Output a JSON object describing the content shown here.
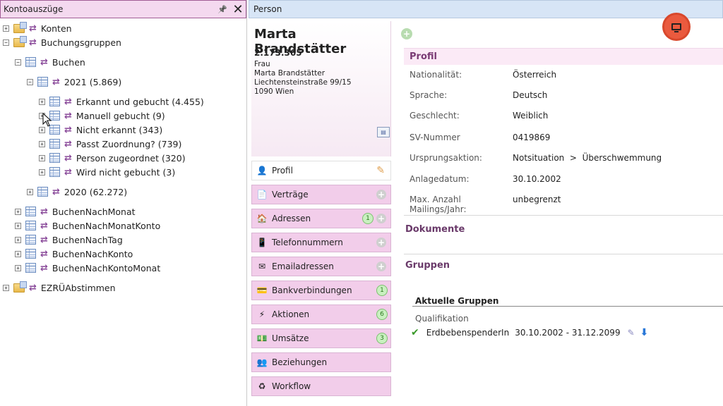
{
  "left_panel": {
    "title": "Kontoauszüge",
    "pin_icon": "pin-icon",
    "close_icon": "close-icon",
    "pin_glyph": "📌",
    "close_glyph": "✕",
    "tree": [
      {
        "label": "Konten",
        "icon": "folder",
        "expander": "+"
      },
      {
        "label": "Buchungsgruppen",
        "icon": "folder",
        "expander": "−"
      },
      {
        "label": "Buchen",
        "icon": "table",
        "expander": "−"
      },
      {
        "label": "2021 (5.869)",
        "icon": "table",
        "expander": "−"
      },
      {
        "label": "Erkannt und gebucht (4.455)",
        "icon": "table",
        "expander": "+"
      },
      {
        "label": "Manuell gebucht (9)",
        "icon": "table",
        "expander": "+"
      },
      {
        "label": "Nicht erkannt (343)",
        "icon": "table",
        "expander": "+"
      },
      {
        "label": "Passt Zuordnung? (739)",
        "icon": "table",
        "expander": "+"
      },
      {
        "label": "Person zugeordnet (320)",
        "icon": "table",
        "expander": "+"
      },
      {
        "label": "Wird nicht gebucht (3)",
        "icon": "table",
        "expander": "+"
      },
      {
        "label": "2020 (62.272)",
        "icon": "table",
        "expander": "+"
      },
      {
        "label": "BuchenNachMonat",
        "icon": "table",
        "expander": "+"
      },
      {
        "label": "BuchenNachMonatKonto",
        "icon": "table",
        "expander": "+"
      },
      {
        "label": "BuchenNachTag",
        "icon": "table",
        "expander": "+"
      },
      {
        "label": "BuchenNachKonto",
        "icon": "table",
        "expander": "+"
      },
      {
        "label": "BuchenNachKontoMonat",
        "icon": "table",
        "expander": "+"
      },
      {
        "label": "EZRÜAbstimmen",
        "icon": "folder",
        "expander": "+"
      }
    ]
  },
  "person": {
    "header": "Person",
    "name": "Marta Brandstätter",
    "number": "2.173.365",
    "address": [
      "Frau",
      "Marta Brandstätter",
      "Liechtensteinstraße 99/15",
      "1090 Wien"
    ]
  },
  "nav": [
    {
      "label": "Profil",
      "icon": "person-icon",
      "glyph": "👤",
      "badge": "",
      "plus": false,
      "active": true
    },
    {
      "label": "Verträge",
      "icon": "contract-icon",
      "glyph": "📄",
      "badge": "",
      "plus": true,
      "active": false
    },
    {
      "label": "Adressen",
      "icon": "house-icon",
      "glyph": "🏠",
      "badge": "1",
      "plus": true,
      "active": false
    },
    {
      "label": "Telefonnummern",
      "icon": "phone-icon",
      "glyph": "📱",
      "badge": "",
      "plus": true,
      "active": false
    },
    {
      "label": "Emailadressen",
      "icon": "envelope-icon",
      "glyph": "✉",
      "badge": "",
      "plus": true,
      "active": false
    },
    {
      "label": "Bankverbindungen",
      "icon": "bank-icon",
      "glyph": "💳",
      "badge": "1",
      "plus": false,
      "active": false
    },
    {
      "label": "Aktionen",
      "icon": "lightning-icon",
      "glyph": "⚡",
      "badge": "6",
      "plus": false,
      "active": false
    },
    {
      "label": "Umsätze",
      "icon": "money-icon",
      "glyph": "💵",
      "badge": "3",
      "plus": false,
      "active": false
    },
    {
      "label": "Beziehungen",
      "icon": "people-icon",
      "glyph": "👥",
      "badge": "",
      "plus": false,
      "active": false
    },
    {
      "label": "Workflow",
      "icon": "workflow-icon",
      "glyph": "♻",
      "badge": "",
      "plus": false,
      "active": false
    }
  ],
  "profil": {
    "title": "Profil",
    "rows": [
      {
        "label": "Nationalität:",
        "value": "Österreich"
      },
      {
        "label": "Sprache:",
        "value": "Deutsch"
      },
      {
        "label": "Geschlecht:",
        "value": "Weiblich"
      },
      {
        "label": "SV-Nummer",
        "value": "0419869"
      },
      {
        "label": "Ursprungsaktion:",
        "value": "Notsituation  >  Überschwemmung"
      },
      {
        "label": "Anlagedatum:",
        "value": "30.10.2002"
      },
      {
        "label": "Max. Anzahl Mailings/Jahr:",
        "value": "unbegrenzt"
      }
    ]
  },
  "dokumente": {
    "title": "Dokumente"
  },
  "gruppen": {
    "title": "Gruppen",
    "aktuelle": "Aktuelle Gruppen",
    "category": "Qualifikation",
    "entry_name": "ErdbebenspenderIn",
    "entry_range": "30.10.2002 - 31.12.2099"
  },
  "colors": {
    "accent": "#7a3a74",
    "nav_bg": "#f2cdea",
    "badge_green": "#c9f0c0",
    "record_button": "#ea5a3e"
  }
}
